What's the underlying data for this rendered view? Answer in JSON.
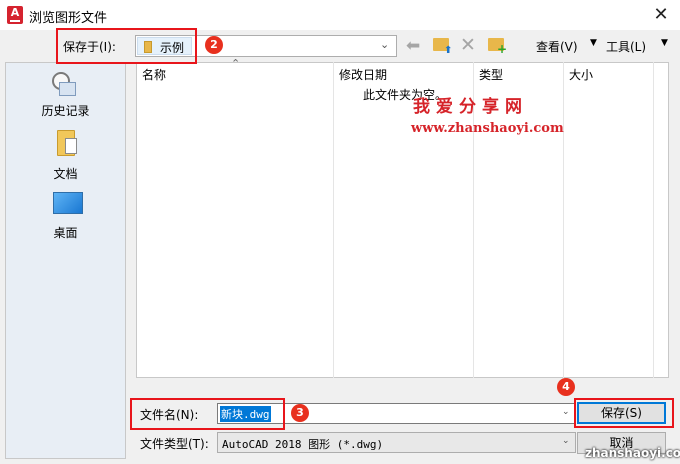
{
  "window": {
    "title": "浏览图形文件",
    "close": "✕"
  },
  "toolbar": {
    "save_in_label": "保存于(I):",
    "location": "示例",
    "view_label": "查看(V)",
    "tools_label": "工具(L)"
  },
  "places": [
    {
      "label": "历史记录",
      "icon": "history-icon"
    },
    {
      "label": "文档",
      "icon": "documents-folder-icon"
    },
    {
      "label": "桌面",
      "icon": "desktop-icon"
    }
  ],
  "file_list": {
    "columns": [
      "名称",
      "修改日期",
      "类型",
      "大小"
    ],
    "empty_message": "此文件夹为空。"
  },
  "form": {
    "filename_label": "文件名(N):",
    "filename_value": "新块.dwg",
    "filetype_label": "文件类型(T):",
    "filetype_value": "AutoCAD 2018 图形 (*.dwg)",
    "save_button": "保存(S)",
    "cancel_button": "取消"
  },
  "annotations": {
    "badges": [
      "2",
      "3",
      "4"
    ],
    "color": "#e8151b"
  },
  "watermark": {
    "title": "我爱分享网",
    "url": "www.zhanshaoyi.com",
    "bottom": "zhanshaoyi.com",
    "color": "#d6242a"
  }
}
